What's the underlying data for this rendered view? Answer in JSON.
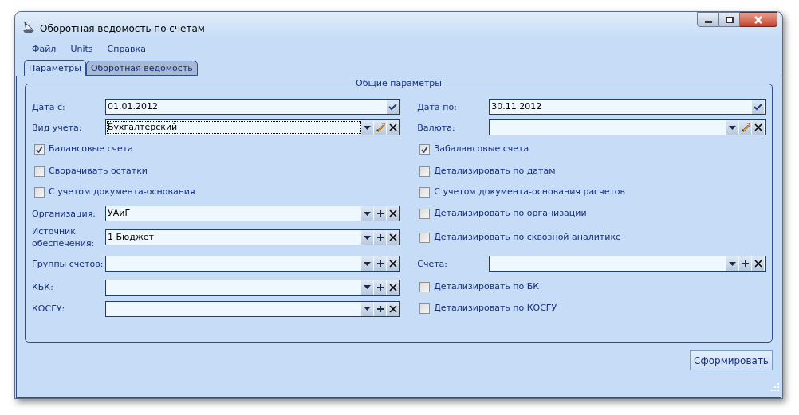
{
  "window": {
    "title": "Оборотная ведомость по счетам"
  },
  "menu": [
    "Файл",
    "Units",
    "Справка"
  ],
  "tabs": [
    {
      "label": "Параметры",
      "selected": true
    },
    {
      "label": "Оборотная ведомость",
      "selected": false
    }
  ],
  "group": {
    "title": "Общие параметры",
    "left": [
      {
        "kind": "date",
        "label": "Дата с:",
        "value": "01.01.2012"
      },
      {
        "kind": "edit-lookup",
        "label": "Вид учета:",
        "value": "Бухгалтерский",
        "focused": true
      },
      {
        "kind": "checkbox",
        "label": "Балансовые счета",
        "checked": true
      },
      {
        "kind": "checkbox",
        "label": "Сворачивать остатки",
        "checked": false
      },
      {
        "kind": "checkbox",
        "label": "С учетом документа-основания",
        "checked": false
      },
      {
        "kind": "add-lookup",
        "label": "Организация:",
        "value": "УАиГ"
      },
      {
        "kind": "add-lookup",
        "label": "Источник обеспечения:",
        "value": "1 Бюджет"
      },
      {
        "kind": "add-lookup",
        "label": "Группы счетов:"
      },
      {
        "kind": "add-lookup",
        "label": "КБК:"
      },
      {
        "kind": "add-lookup",
        "label": "КОСГУ:"
      }
    ],
    "right": [
      {
        "kind": "date",
        "label": "Дата по:",
        "value": "30.11.2012"
      },
      {
        "kind": "edit-lookup",
        "label": "Валюта:"
      },
      {
        "kind": "checkbox",
        "label": "Забалансовые счета",
        "checked": true
      },
      {
        "kind": "checkbox",
        "label": "Детализировать по датам",
        "checked": false
      },
      {
        "kind": "checkbox",
        "label": "С учетом документа-основания расчетов",
        "checked": false
      },
      {
        "kind": "checkbox",
        "label": "Детализировать по организации",
        "checked": false
      },
      {
        "kind": "checkbox",
        "label": "Детализировать по сквозной аналитике",
        "checked": false
      },
      {
        "kind": "add-lookup",
        "label": "Счета:"
      },
      {
        "kind": "checkbox",
        "label": "Детализировать по БК",
        "checked": false
      },
      {
        "kind": "checkbox",
        "label": "Детализировать по КОСГУ",
        "checked": false
      }
    ]
  },
  "submit_button": "Сформировать"
}
